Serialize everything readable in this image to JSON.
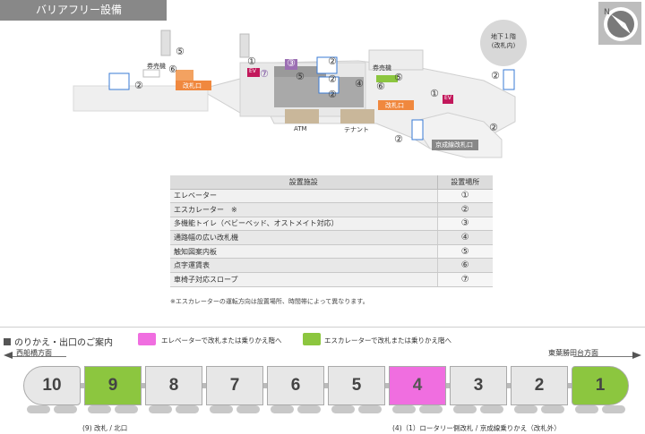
{
  "header": {
    "title": "バリアフリー設備"
  },
  "floor": {
    "label_line1": "地下１階",
    "label_line2": "(改札内)"
  },
  "map": {
    "labels": {
      "ticket_machine_left": "券売機",
      "ticket_machine_right": "券売機",
      "gate_left": "改札口",
      "gate_center": "改札口",
      "atm": "ATM",
      "tenant": "テナント",
      "keisei_gate": "京成線改札口",
      "ev": "EV",
      "es": "ES"
    },
    "markers": [
      "①",
      "②",
      "③",
      "④",
      "⑤",
      "⑥",
      "⑦"
    ]
  },
  "facilities": {
    "headers": {
      "name": "設置施設",
      "place": "設置場所"
    },
    "rows": [
      {
        "name": "エレベーター",
        "mark": "①"
      },
      {
        "name": "エスカレーター　※",
        "mark": "②"
      },
      {
        "name": "多機能トイレ（ベビーベッド、オストメイト対応）",
        "mark": "③"
      },
      {
        "name": "通路幅の広い改札機",
        "mark": "④"
      },
      {
        "name": "触知図案内板",
        "mark": "⑤"
      },
      {
        "name": "点字運賃表",
        "mark": "⑥"
      },
      {
        "name": "車椅子対応スロープ",
        "mark": "⑦"
      }
    ],
    "note": "※エスカレーターの運転方向は設置場所、時間帯によって異なります。"
  },
  "transfer": {
    "title": "のりかえ・出口のご案内",
    "legend_pink": "エレベーターで改札または乗りかえ階へ",
    "legend_green": "エスカレーターで改札または乗りかえ階へ",
    "colors": {
      "pink": "#f06ee0",
      "green": "#8cc63f",
      "gray": "#e7e7e7"
    },
    "direction_left": "西船橋方面",
    "direction_right": "東葉勝田台方面",
    "cars": [
      {
        "number": "10",
        "type": "gray"
      },
      {
        "number": "9",
        "type": "green"
      },
      {
        "number": "8",
        "type": "gray"
      },
      {
        "number": "7",
        "type": "gray"
      },
      {
        "number": "6",
        "type": "gray"
      },
      {
        "number": "5",
        "type": "gray"
      },
      {
        "number": "4",
        "type": "pink"
      },
      {
        "number": "3",
        "type": "gray"
      },
      {
        "number": "2",
        "type": "gray"
      },
      {
        "number": "1",
        "type": "green"
      }
    ],
    "exit_note_left": "(9) 改札 / 北口",
    "exit_note_right": "(4)（1）ロータリー側改札 / 京成線乗りかえ（改札外）"
  }
}
